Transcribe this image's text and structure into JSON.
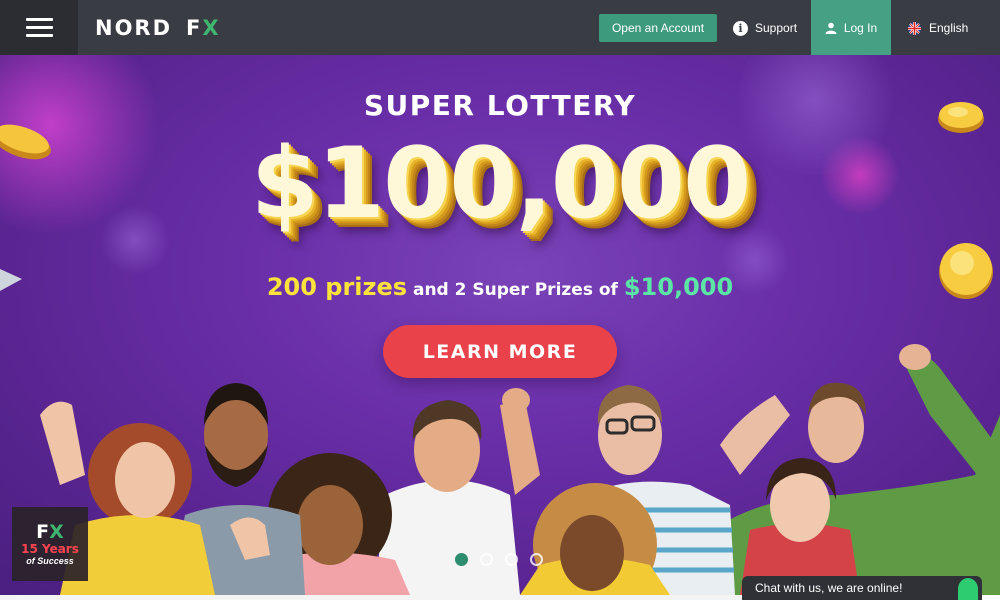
{
  "header": {
    "logo_text": "NORD",
    "logo_fx_f": "F",
    "logo_fx_x": "X",
    "open_account_label": "Open an Account",
    "support_label": "Support",
    "login_label": "Log In",
    "language_label": "English",
    "accent_color": "#3d9a7d"
  },
  "hero": {
    "title": "SUPER LOTTERY",
    "amount": "$100,000",
    "sub_prizes": "200 prizes",
    "sub_middle": "and 2 Super Prizes of",
    "sub_amount": "$10,000",
    "button_label": "LEARN MORE",
    "button_color": "#e9424a",
    "slides_total": 4,
    "active_slide": 1
  },
  "badge": {
    "fx_f": "F",
    "fx_x": "X",
    "years": "15 Years",
    "success": "of Success"
  },
  "chat": {
    "label": "Chat with us, we are online!"
  }
}
